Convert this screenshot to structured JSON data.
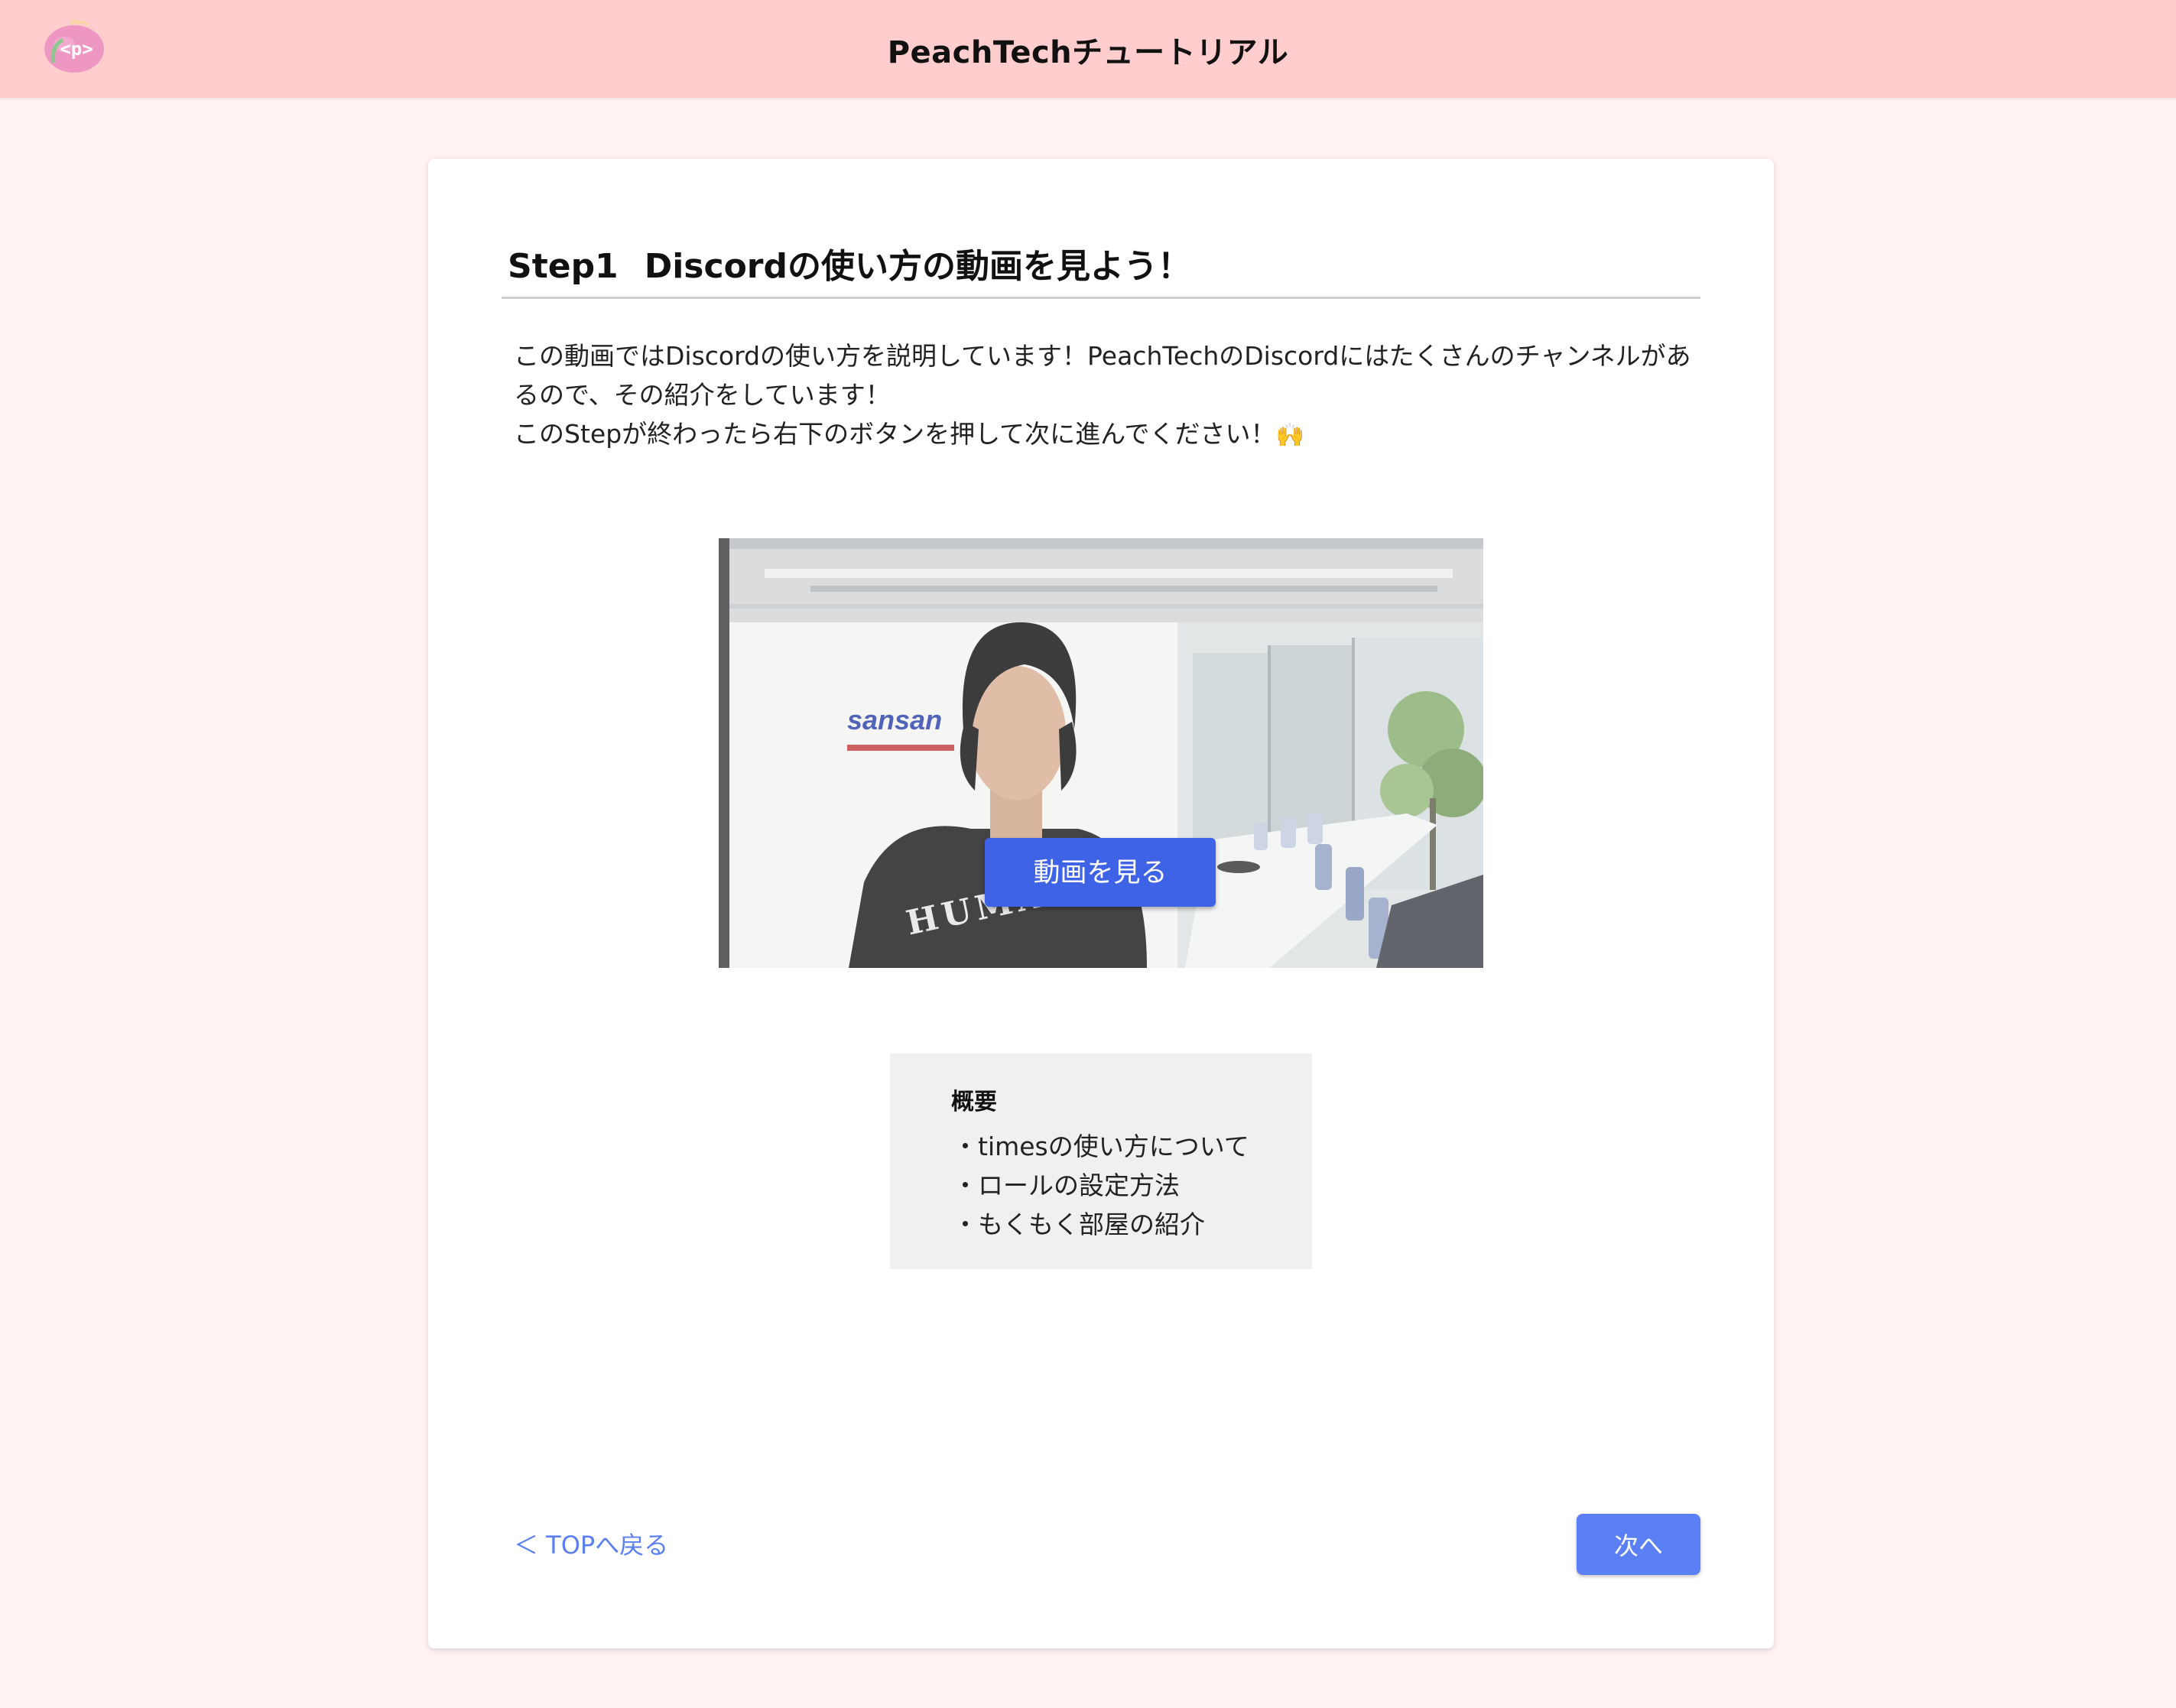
{
  "header": {
    "title": "PeachTechチュートリアル",
    "logo_text": "<p>",
    "background_color": "#ffcdcd"
  },
  "step": {
    "number": "Step1",
    "title": "Discordの使い方の動画を見よう！"
  },
  "description": {
    "line1": "この動画ではDiscordの使い方を説明しています！PeachTechのDiscordにはたくさんのチャンネルがあるので、その紹介をしています！",
    "line2": "このStepが終わったら右下のボタンを押して次に進んでください！",
    "emoji": "🙌"
  },
  "video": {
    "brand_text": "sansan",
    "shirt_text": "HUMAN",
    "watch_button_label": "動画を見る",
    "button_color": "#3f63e6"
  },
  "summary": {
    "heading": "概要",
    "items": [
      "timesの使い方について",
      "ロールの設定方法",
      "もくもく部屋の紹介"
    ]
  },
  "footer": {
    "back_label": "＜ TOPへ戻る",
    "next_label": "次へ",
    "accent_color": "#5b7ff5"
  }
}
